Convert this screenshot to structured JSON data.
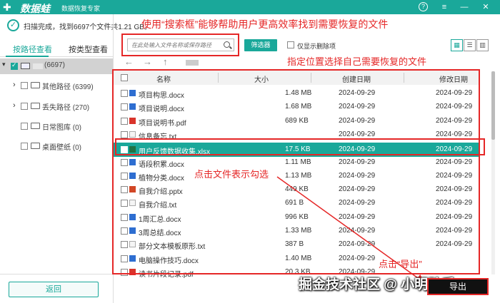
{
  "app": {
    "logo_glyph": "✚",
    "name": "数据蛙",
    "subtitle": "数据恢复专家"
  },
  "window": {
    "help": "?",
    "menu": "≡",
    "minimize": "—",
    "close": "✕"
  },
  "status": {
    "text": "扫描完成，找到6697个文件共1.21 GB。"
  },
  "annotations": {
    "search_tip": "使用“搜索框”能够帮助用户更高效率找到需要恢复的文件",
    "location_tip": "指定位置选择自己需要恢复的文件",
    "click_tip": "点击文件表示勾选",
    "export_tip": "点击“导出”"
  },
  "left_tabs": {
    "by_path": "按路径查看",
    "by_type": "按类型查看"
  },
  "tree": {
    "root_count": "(6697)",
    "items": [
      {
        "label": "其他路径 (6399)",
        "expandable": true
      },
      {
        "label": "丢失路径 (270)",
        "expandable": true
      },
      {
        "label": "日常图库 (0)",
        "expandable": false
      },
      {
        "label": "桌面壁纸 (0)",
        "expandable": false
      }
    ]
  },
  "back_label": "返回",
  "search": {
    "placeholder": "在此处输入文件名称或保存路径"
  },
  "filter_label": "筛选器",
  "show_deleted_label": "仅显示删除项",
  "nav": {
    "back": "←",
    "forward": "→",
    "up": "↑"
  },
  "table": {
    "headers": {
      "name": "名称",
      "size": "大小",
      "created": "创建日期",
      "modified": "修改日期"
    },
    "rows": [
      {
        "name": "项目构思.docx",
        "size": "1.48 MB",
        "created": "2024-09-29",
        "modified": "2024-09-29",
        "type": "word"
      },
      {
        "name": "项目说明.docx",
        "size": "1.68 MB",
        "created": "2024-09-29",
        "modified": "2024-09-29",
        "type": "word"
      },
      {
        "name": "项目说明书.pdf",
        "size": "689 KB",
        "created": "2024-09-29",
        "modified": "2024-09-29",
        "type": "pdf"
      },
      {
        "name": "信息备忘.txt",
        "size": "",
        "created": "2024-09-29",
        "modified": "2024-09-29",
        "type": "txt"
      },
      {
        "name": "用户反馈数据收集.xlsx",
        "size": "17.5 KB",
        "created": "2024-09-29",
        "modified": "2024-09-29",
        "type": "excel",
        "selected": true
      },
      {
        "name": "语段积累.docx",
        "size": "1.11 MB",
        "created": "2024-09-29",
        "modified": "2024-09-29",
        "type": "word"
      },
      {
        "name": "植物分类.docx",
        "size": "1.13 MB",
        "created": "2024-09-29",
        "modified": "2024-09-29",
        "type": "word"
      },
      {
        "name": "自我介绍.pptx",
        "size": "449 KB",
        "created": "2024-09-29",
        "modified": "2024-09-29",
        "type": "ppt"
      },
      {
        "name": "自我介绍.txt",
        "size": "691 B",
        "created": "2024-09-29",
        "modified": "2024-09-29",
        "type": "txt"
      },
      {
        "name": "1周汇总.docx",
        "size": "996 KB",
        "created": "2024-09-29",
        "modified": "2024-09-29",
        "type": "word"
      },
      {
        "name": "3周总结.docx",
        "size": "1.33 MB",
        "created": "2024-09-29",
        "modified": "2024-09-29",
        "type": "word"
      },
      {
        "name": "部分文本模板原形.txt",
        "size": "387 B",
        "created": "2024-09-29",
        "modified": "2024-09-29",
        "type": "txt"
      },
      {
        "name": "电脑操作技巧.docx",
        "size": "1.40 MB",
        "created": "2024-09-29",
        "modified": "",
        "type": "word"
      },
      {
        "name": "读书片段记录.pdf",
        "size": "20.3 KB",
        "created": "2024-09-29",
        "modified": "",
        "type": "pdf"
      }
    ]
  },
  "view_toggles": [
    "▦",
    "☰",
    "▥"
  ],
  "export_label": "导出",
  "watermark": "掘金技术社区 @ 小明助手",
  "colors": {
    "accent": "#1aa89a",
    "annotation": "#e52727"
  }
}
